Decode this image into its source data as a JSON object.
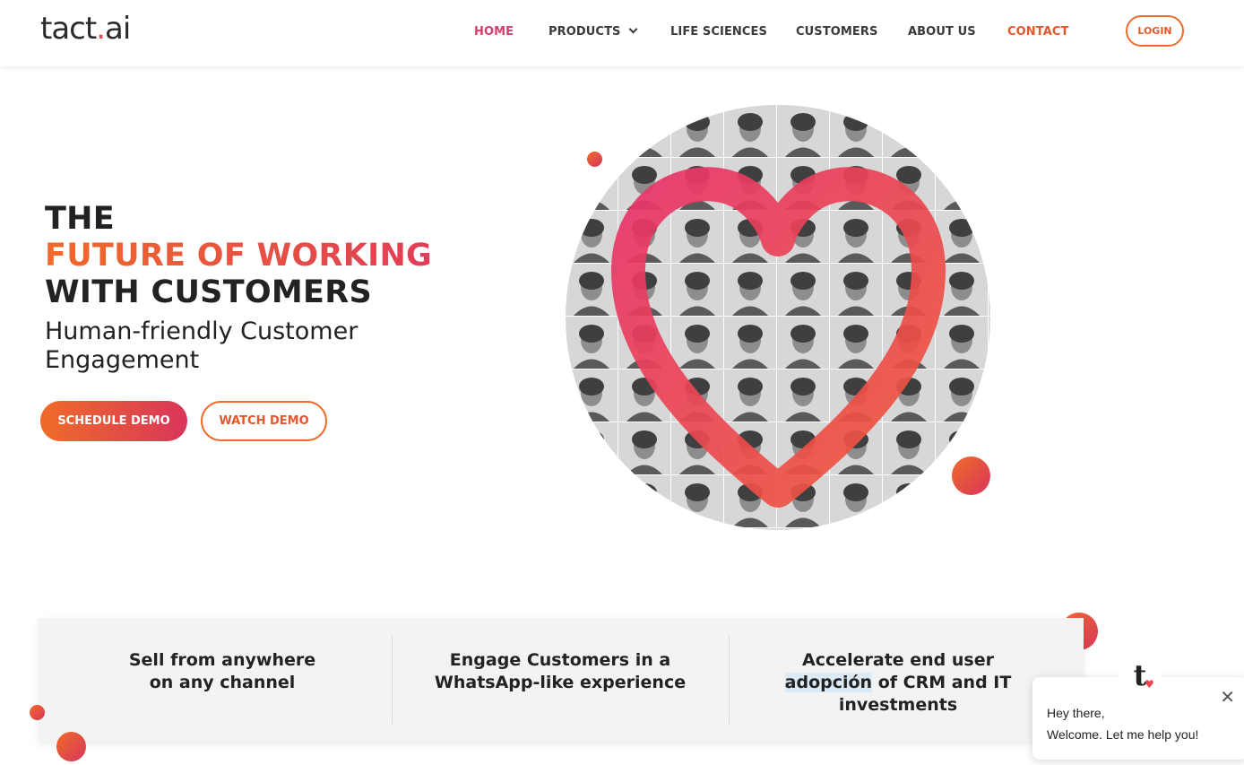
{
  "header": {
    "logo": {
      "prefix": "tact",
      "dot": ".",
      "suffix": "ai"
    },
    "nav": [
      {
        "label": "HOME",
        "state": "active"
      },
      {
        "label": "PRODUCTS",
        "has_dropdown": true
      },
      {
        "label": "LIFE SCIENCES"
      },
      {
        "label": "CUSTOMERS"
      },
      {
        "label": "ABOUT US"
      },
      {
        "label": "CONTACT",
        "state": "highlight"
      }
    ],
    "login_label": "LOGIN"
  },
  "hero": {
    "line1": "THE",
    "line2": "FUTURE OF WORKING",
    "line3": "WITH CUSTOMERS",
    "subtitle": "Human-friendly Customer Engagement",
    "primary_cta": "SCHEDULE DEMO",
    "secondary_cta": "WATCH DEMO"
  },
  "features": [
    {
      "line1": "Sell from anywhere",
      "line2": "on any channel"
    },
    {
      "line1": "Engage Customers in a",
      "line2": "WhatsApp-like experience"
    },
    {
      "line1": "Accelerate end user",
      "line2_highlight": "adopción",
      "line2_rest": " of CRM and IT",
      "line3": "investments"
    }
  ],
  "chat": {
    "avatar_letter": "t",
    "greeting": "Hey there,",
    "message": "Welcome. Let me help you!"
  },
  "colors": {
    "accent_orange": "#ef6b2a",
    "accent_pink": "#d8365a",
    "nav_active": "#d43e6b",
    "text_dark": "#222222"
  }
}
